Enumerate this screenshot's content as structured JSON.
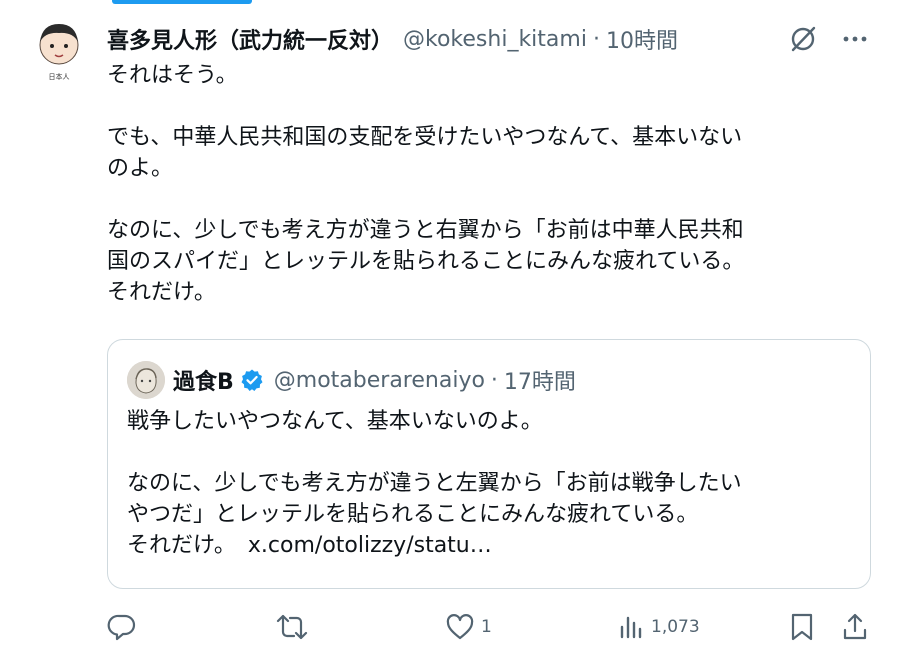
{
  "author": {
    "display_name": "喜多見人形（武力統一反対）",
    "handle": "@kokeshi_kitami",
    "time": "10時間",
    "avatar_caption": "日本人"
  },
  "tweet": {
    "lines": [
      "それはそう。",
      "",
      "でも、中華人民共和国の支配を受けたいやつなんて、基本いない",
      "のよ。",
      "",
      "なのに、少しでも考え方が違うと右翼から「お前は中華人民共和",
      "国のスパイだ」とレッテルを貼られることにみんな疲れている。",
      "それだけ。"
    ]
  },
  "quote": {
    "display_name": "過食B",
    "handle": "@motaberarenaiyo",
    "time": "17時間",
    "lines": [
      "戦争したいやつなんて、基本いないのよ。",
      "",
      "なのに、少しでも考え方が違うと左翼から「お前は戦争したい",
      "やつだ」とレッテルを貼られることにみんな疲れている。",
      "それだけ。"
    ],
    "link": "x.com/otolizzy/statu…"
  },
  "actions": {
    "reply_count": "",
    "retweet_count": "",
    "like_count": "1",
    "views_count": "1,073"
  },
  "colors": {
    "accent": "#1d9bf0",
    "text": "#0f1419",
    "secondary": "#536471",
    "border": "#cfd9de"
  },
  "icons": [
    "grok-icon",
    "more-icon",
    "verified-icon",
    "reply-icon",
    "retweet-icon",
    "like-icon",
    "views-icon",
    "bookmark-icon",
    "share-icon"
  ]
}
